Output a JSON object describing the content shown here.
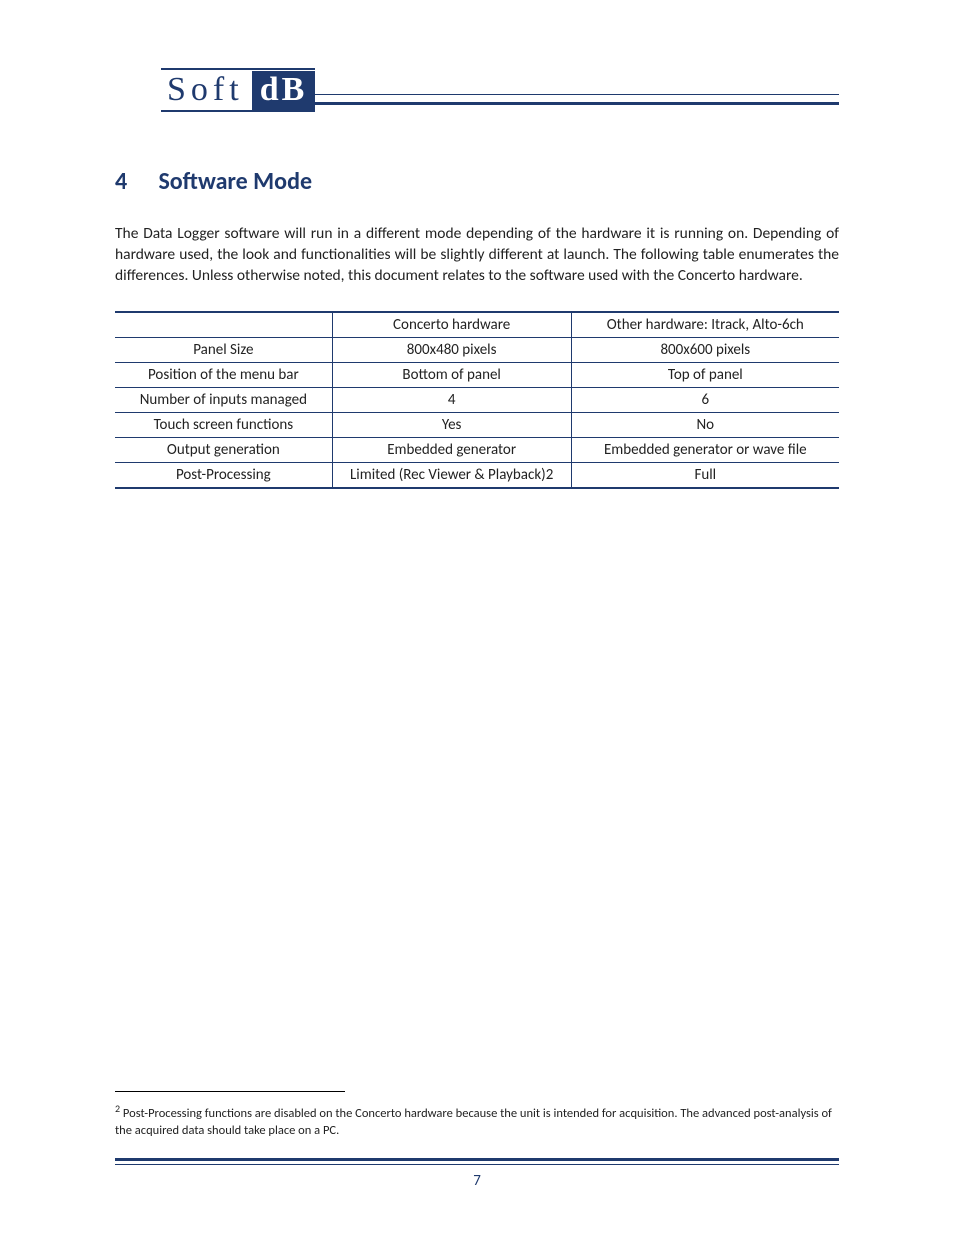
{
  "logo": {
    "part1": "Soft",
    "part2": "dB"
  },
  "section": {
    "number": "4",
    "title": "Software Mode"
  },
  "paragraph": "The Data Logger software will run in a different mode depending of the hardware it is running on. Depending of hardware used, the look and functionalities will be slightly different at launch. The following table enumerates the differences. Unless otherwise noted, this document relates to the software used with the Concerto hardware.",
  "table": {
    "head": [
      "",
      "Concerto hardware",
      "Other hardware: Itrack, Alto-6ch"
    ],
    "rows": [
      [
        "Panel Size",
        "800x480 pixels",
        "800x600 pixels"
      ],
      [
        "Position of the menu bar",
        "Bottom of panel",
        "Top of panel"
      ],
      [
        "Number of inputs managed",
        "4",
        "6"
      ],
      [
        "Touch screen functions",
        "Yes",
        "No"
      ],
      [
        "Output generation",
        "Embedded generator",
        "Embedded generator or wave file"
      ],
      [
        "Post-Processing",
        "Limited (Rec Viewer & Playback)2",
        "Full"
      ]
    ]
  },
  "footnote": {
    "marker": "2",
    "text": " Post-Processing functions are disabled on the Concerto hardware because the unit is intended for acquisition. The advanced post-analysis of the acquired data should take place on a PC."
  },
  "pageNumber": "7"
}
